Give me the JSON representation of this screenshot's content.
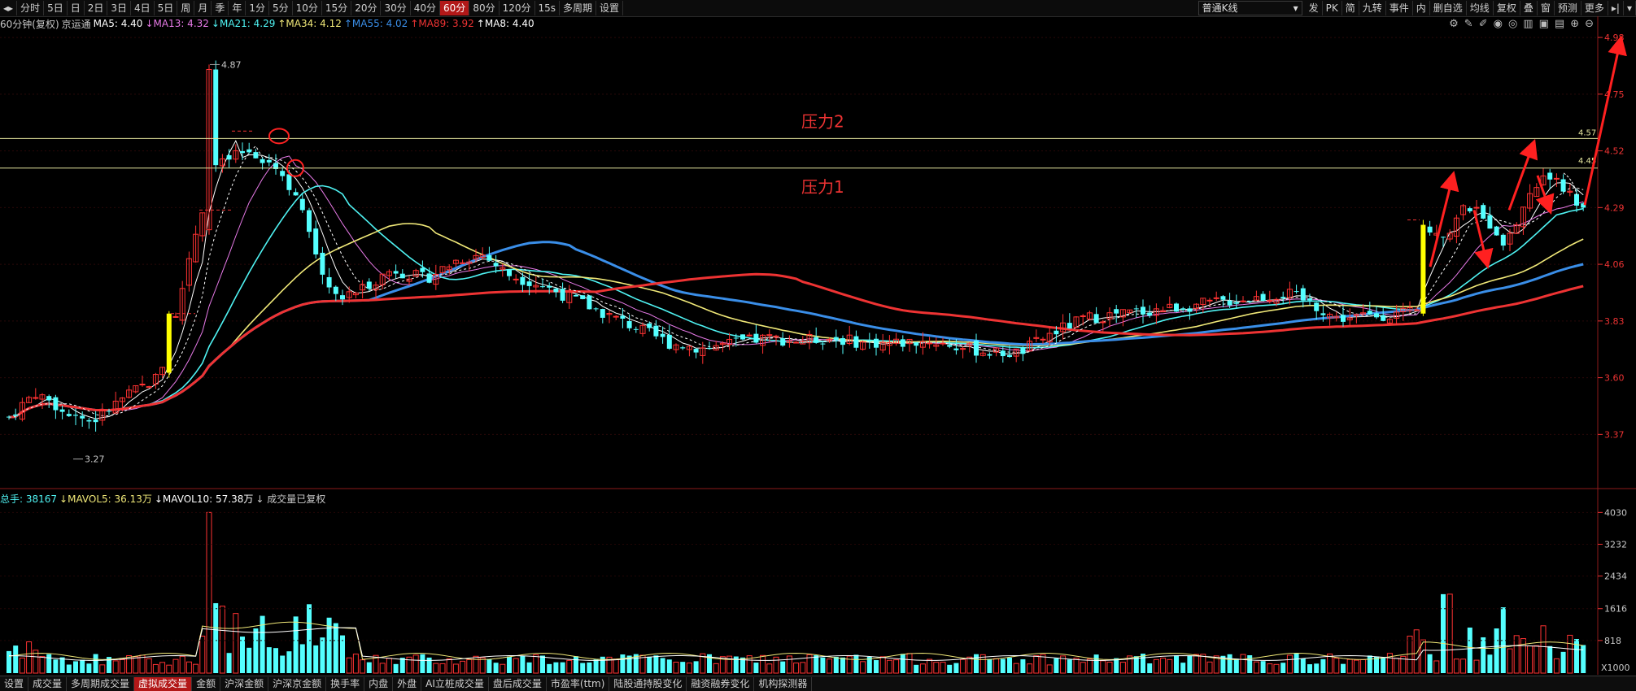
{
  "toolbar": {
    "periods": [
      "分时",
      "5日",
      "日",
      "2日",
      "3日",
      "4日",
      "5日",
      "周",
      "月",
      "季",
      "年",
      "1分",
      "5分",
      "10分",
      "15分",
      "20分",
      "30分",
      "40分",
      "60分",
      "80分",
      "120分",
      "15s",
      "多周期",
      "设置"
    ],
    "active_period": "60分",
    "kline_type": "普通K线",
    "right_items": [
      "发",
      "PK",
      "简",
      "九转",
      "事件",
      "内",
      "删自选",
      "均线",
      "复权",
      "叠",
      "窗",
      "预测",
      "更多"
    ]
  },
  "ma_legend": {
    "period_label": "60分钟(复权)",
    "stock_name": "京运通",
    "items": [
      {
        "label": "MA5: 4.40",
        "dir": "",
        "color": "#ffffff"
      },
      {
        "label": "MA13: 4.32",
        "dir": "↓",
        "color": "#e87ae8"
      },
      {
        "label": "MA21: 4.29",
        "dir": "↓",
        "color": "#4ff3f3"
      },
      {
        "label": "MA34: 4.12",
        "dir": "↑",
        "color": "#f0e878"
      },
      {
        "label": "MA55: 4.02",
        "dir": "↑",
        "color": "#3a8ee8"
      },
      {
        "label": "MA89: 3.92",
        "dir": "↑",
        "color": "#ee3333"
      },
      {
        "label": "MA8: 4.40",
        "dir": "↑",
        "color": "#ffffff"
      }
    ]
  },
  "price_axis": {
    "min": 3.17,
    "max": 5.0,
    "ticks": [
      "4.98",
      "4.75",
      "4.52",
      "4.29",
      "4.06",
      "3.83",
      "3.60",
      "3.37"
    ]
  },
  "annotations": {
    "pressure1": "压力1",
    "pressure2": "压力2",
    "line1_value": "4.45",
    "line2_value": "4.57",
    "high_label": "4.87",
    "low_label": "3.27"
  },
  "volume_legend": {
    "items": [
      {
        "label": "总手: 38167",
        "color": "#4ff3f3"
      },
      {
        "label": "↓MAVOL5: 36.13万",
        "color": "#f0e878"
      },
      {
        "label": "↓MAVOL10: 57.38万",
        "color": "#ffffff"
      },
      {
        "label": "↓ 成交量已复权",
        "color": "#c8c8c8"
      }
    ]
  },
  "volume_axis": {
    "ticks": [
      "4030",
      "3232",
      "2434",
      "1616",
      "818"
    ],
    "unit": "X1000"
  },
  "bottom_tabs": [
    "设置",
    "成交量",
    "多周期成交量",
    "虚拟成交量",
    "金额",
    "沪深金额",
    "沪深京金额",
    "换手率",
    "内盘",
    "外盘",
    "AI立桩成交量",
    "盘后成交量",
    "市盈率(ttm)",
    "陆股通持股变化",
    "融资融券变化",
    "机构探测器"
  ],
  "active_tab": "虚拟成交量",
  "colors": {
    "up": "#ff3232",
    "down": "#54ffff",
    "accent": "#b21818",
    "highlight": "#ffff00"
  },
  "chart_data": {
    "type": "candlestick",
    "series": [
      {
        "name": "MA5",
        "color": "#ffffff"
      },
      {
        "name": "MA13",
        "color": "#e87ae8"
      },
      {
        "name": "MA21",
        "color": "#4ff3f3"
      },
      {
        "name": "MA34",
        "color": "#f0e878"
      },
      {
        "name": "MA55",
        "color": "#3a8ee8"
      },
      {
        "name": "MA89",
        "color": "#ee3333"
      }
    ],
    "ohlc_approx": [
      [
        3.42,
        3.48,
        3.4,
        3.46
      ],
      [
        3.46,
        3.52,
        3.44,
        3.5
      ],
      [
        3.5,
        3.58,
        3.48,
        3.56
      ],
      [
        3.56,
        3.62,
        3.52,
        3.54
      ],
      [
        3.54,
        3.56,
        3.45,
        3.48
      ],
      [
        3.48,
        3.5,
        3.36,
        3.4
      ],
      [
        3.4,
        3.45,
        3.34,
        3.42
      ],
      [
        3.42,
        3.54,
        3.4,
        3.52
      ],
      [
        3.52,
        3.62,
        3.5,
        3.58
      ],
      [
        3.58,
        3.65,
        3.55,
        3.6
      ],
      [
        3.6,
        3.62,
        3.52,
        3.55
      ],
      [
        3.55,
        3.87,
        3.55,
        3.86
      ],
      [
        3.86,
        4.4,
        3.84,
        4.38
      ],
      [
        4.38,
        4.87,
        4.35,
        4.55
      ],
      [
        4.55,
        4.6,
        4.38,
        4.42
      ],
      [
        4.42,
        4.46,
        4.2,
        4.25
      ],
      [
        4.25,
        4.28,
        3.95,
        4.0
      ],
      [
        4.0,
        4.05,
        3.82,
        3.9
      ],
      [
        3.9,
        4.0,
        3.85,
        3.98
      ],
      [
        3.98,
        4.08,
        3.92,
        4.04
      ],
      [
        4.04,
        4.1,
        3.96,
        4.0
      ],
      [
        4.0,
        4.15,
        3.98,
        4.12
      ],
      [
        4.12,
        4.18,
        4.05,
        4.08
      ],
      [
        4.08,
        4.12,
        3.95,
        3.98
      ],
      [
        3.98,
        4.02,
        3.92,
        3.95
      ],
      [
        3.95,
        3.98,
        3.85,
        3.88
      ],
      [
        3.88,
        3.92,
        3.8,
        3.82
      ],
      [
        3.82,
        3.86,
        3.74,
        3.76
      ],
      [
        3.76,
        3.8,
        3.7,
        3.72
      ],
      [
        3.72,
        3.76,
        3.64,
        3.68
      ],
      [
        3.68,
        3.74,
        3.66,
        3.72
      ],
      [
        3.72,
        3.76,
        3.7,
        3.74
      ],
      [
        3.74,
        3.78,
        3.72,
        3.75
      ],
      [
        3.75,
        3.8,
        3.72,
        3.76
      ],
      [
        3.76,
        3.78,
        3.72,
        3.74
      ],
      [
        3.74,
        3.76,
        3.66,
        3.68
      ],
      [
        3.68,
        3.74,
        3.66,
        3.72
      ],
      [
        3.72,
        3.8,
        3.7,
        3.78
      ],
      [
        3.78,
        3.86,
        3.76,
        3.84
      ],
      [
        3.84,
        3.9,
        3.82,
        3.88
      ],
      [
        3.88,
        3.94,
        3.86,
        3.92
      ],
      [
        3.92,
        3.96,
        3.88,
        3.94
      ],
      [
        3.94,
        3.98,
        3.9,
        3.92
      ],
      [
        3.92,
        3.96,
        3.84,
        3.86
      ],
      [
        3.86,
        3.9,
        3.78,
        3.82
      ],
      [
        3.82,
        3.86,
        3.78,
        3.84
      ],
      [
        3.84,
        4.26,
        3.84,
        4.24
      ],
      [
        4.24,
        4.4,
        4.1,
        4.15
      ],
      [
        4.15,
        4.38,
        4.05,
        4.22
      ],
      [
        4.22,
        4.52,
        4.2,
        4.48
      ],
      [
        4.48,
        4.55,
        4.3,
        4.35
      ]
    ]
  }
}
